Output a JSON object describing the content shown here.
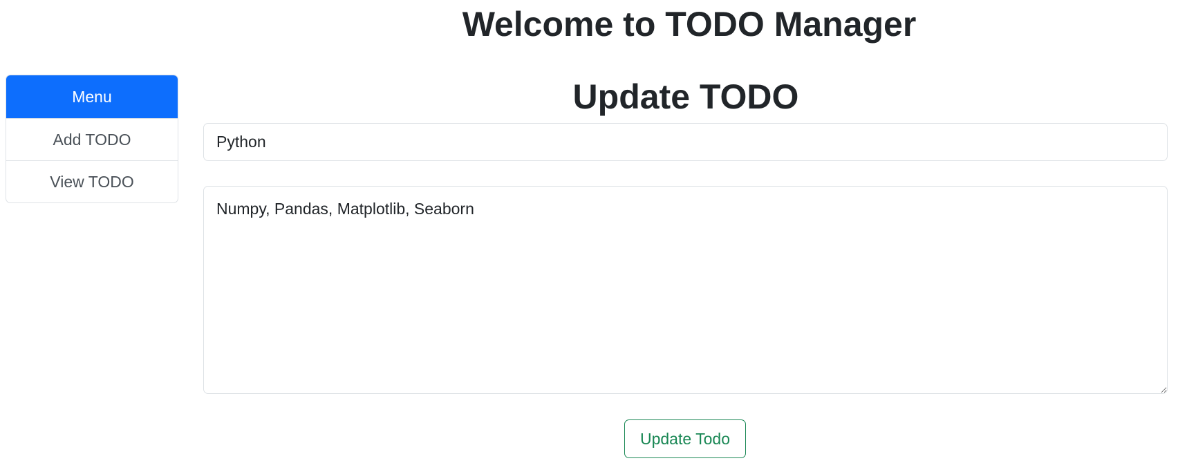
{
  "header": {
    "title": "Welcome to TODO Manager"
  },
  "sidebar": {
    "items": [
      {
        "label": "Menu",
        "active": true
      },
      {
        "label": "Add TODO",
        "active": false
      },
      {
        "label": "View TODO",
        "active": false
      }
    ]
  },
  "main": {
    "form_title": "Update TODO",
    "title_field": {
      "value": "Python"
    },
    "description_field": {
      "value": "Numpy, Pandas, Matplotlib, Seaborn"
    },
    "submit_label": "Update Todo"
  },
  "colors": {
    "primary": "#0d6efd",
    "success": "#198754",
    "border": "#dee2e6",
    "text": "#212529"
  }
}
